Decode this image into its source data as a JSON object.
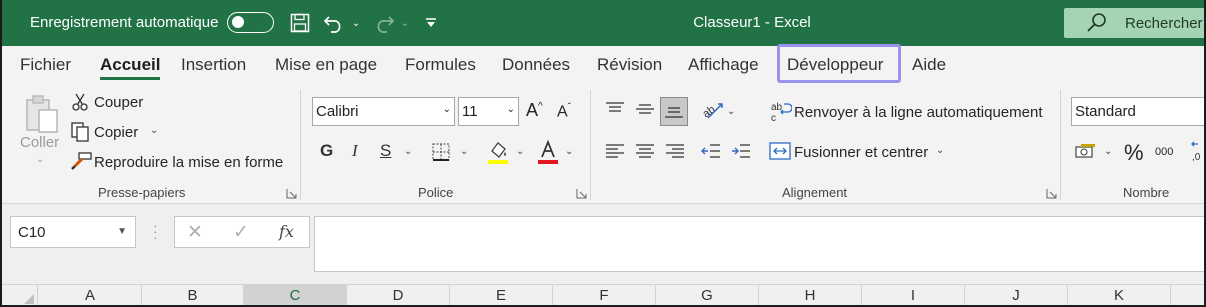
{
  "titlebar": {
    "autosave_label": "Enregistrement automatique",
    "autosave_state": "off",
    "title": "Classeur1  -  Excel",
    "search_label": "Rechercher (",
    "bg_color": "#217346"
  },
  "menu": {
    "tabs": [
      "Fichier",
      "Accueil",
      "Insertion",
      "Mise en page",
      "Formules",
      "Données",
      "Révision",
      "Affichage",
      "Développeur",
      "Aide"
    ],
    "active": "Accueil",
    "highlighted": "Développeur"
  },
  "ribbon": {
    "clipboard": {
      "paste": "Coller",
      "cut": "Couper",
      "copy": "Copier",
      "format_painter": "Reproduire la mise en forme",
      "label": "Presse-papiers"
    },
    "font": {
      "name": "Calibri",
      "size": "11",
      "bold": "G",
      "italic": "I",
      "underline": "S",
      "label": "Police",
      "highlight_color": "#ffff00",
      "font_color": "#e0161c"
    },
    "alignment": {
      "wrap_text": "Renvoyer à la ligne automatiquement",
      "merge": "Fusionner et centrer",
      "label": "Alignement"
    },
    "number": {
      "format": "Standard",
      "percent": "%",
      "thousands": "000",
      "label": "Nombre"
    }
  },
  "formula_bar": {
    "name_box": "C10",
    "cancel": "✕",
    "confirm": "✓",
    "fx": "fx",
    "formula": ""
  },
  "columns": [
    "A",
    "B",
    "C",
    "D",
    "E",
    "F",
    "G",
    "H",
    "I",
    "J",
    "K"
  ],
  "selected_column": "C"
}
